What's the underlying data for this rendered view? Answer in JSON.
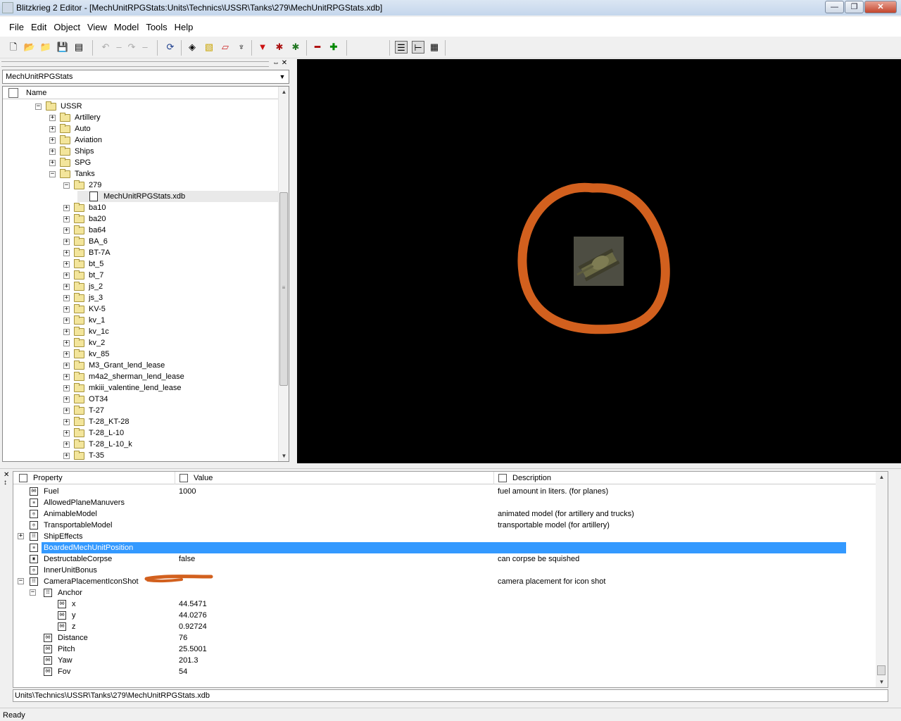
{
  "window": {
    "title": "Blitzkrieg 2 Editor - [MechUnitRPGStats:Units\\Technics\\USSR\\Tanks\\279\\MechUnitRPGStats.xdb]",
    "minimize": "—",
    "maximize": "❐",
    "close": "✕"
  },
  "menu": [
    "File",
    "Edit",
    "Object",
    "View",
    "Model",
    "Tools",
    "Help"
  ],
  "left_panel": {
    "combo_value": "MechUnitRPGStats",
    "tree_header": "Name",
    "tree": [
      {
        "label": "USSR",
        "indent": 0,
        "expanded": true,
        "type": "folder"
      },
      {
        "label": "Artillery",
        "indent": 1,
        "expanded": false,
        "type": "folder"
      },
      {
        "label": "Auto",
        "indent": 1,
        "expanded": false,
        "type": "folder"
      },
      {
        "label": "Aviation",
        "indent": 1,
        "expanded": false,
        "type": "folder"
      },
      {
        "label": "Ships",
        "indent": 1,
        "expanded": false,
        "type": "folder"
      },
      {
        "label": "SPG",
        "indent": 1,
        "expanded": false,
        "type": "folder"
      },
      {
        "label": "Tanks",
        "indent": 1,
        "expanded": true,
        "type": "folder"
      },
      {
        "label": "279",
        "indent": 2,
        "expanded": true,
        "type": "folder"
      },
      {
        "label": "MechUnitRPGStats.xdb",
        "indent": 3,
        "type": "file",
        "selected": true
      },
      {
        "label": "ba10",
        "indent": 2,
        "expanded": false,
        "type": "folder"
      },
      {
        "label": "ba20",
        "indent": 2,
        "expanded": false,
        "type": "folder"
      },
      {
        "label": "ba64",
        "indent": 2,
        "expanded": false,
        "type": "folder"
      },
      {
        "label": "BA_6",
        "indent": 2,
        "expanded": false,
        "type": "folder"
      },
      {
        "label": "BT-7A",
        "indent": 2,
        "expanded": false,
        "type": "folder"
      },
      {
        "label": "bt_5",
        "indent": 2,
        "expanded": false,
        "type": "folder"
      },
      {
        "label": "bt_7",
        "indent": 2,
        "expanded": false,
        "type": "folder"
      },
      {
        "label": "js_2",
        "indent": 2,
        "expanded": false,
        "type": "folder"
      },
      {
        "label": "js_3",
        "indent": 2,
        "expanded": false,
        "type": "folder"
      },
      {
        "label": "KV-5",
        "indent": 2,
        "expanded": false,
        "type": "folder"
      },
      {
        "label": "kv_1",
        "indent": 2,
        "expanded": false,
        "type": "folder"
      },
      {
        "label": "kv_1c",
        "indent": 2,
        "expanded": false,
        "type": "folder"
      },
      {
        "label": "kv_2",
        "indent": 2,
        "expanded": false,
        "type": "folder"
      },
      {
        "label": "kv_85",
        "indent": 2,
        "expanded": false,
        "type": "folder"
      },
      {
        "label": "M3_Grant_lend_lease",
        "indent": 2,
        "expanded": false,
        "type": "folder"
      },
      {
        "label": "m4a2_sherman_lend_lease",
        "indent": 2,
        "expanded": false,
        "type": "folder"
      },
      {
        "label": "mkiii_valentine_lend_lease",
        "indent": 2,
        "expanded": false,
        "type": "folder"
      },
      {
        "label": "OT34",
        "indent": 2,
        "expanded": false,
        "type": "folder"
      },
      {
        "label": "T-27",
        "indent": 2,
        "expanded": false,
        "type": "folder"
      },
      {
        "label": "T-28_KT-28",
        "indent": 2,
        "expanded": false,
        "type": "folder"
      },
      {
        "label": "T-28_L-10",
        "indent": 2,
        "expanded": false,
        "type": "folder"
      },
      {
        "label": "T-28_L-10_k",
        "indent": 2,
        "expanded": false,
        "type": "folder"
      },
      {
        "label": "T-35",
        "indent": 2,
        "expanded": false,
        "type": "folder"
      }
    ]
  },
  "properties": {
    "headers": {
      "property": "Property",
      "value": "Value",
      "description": "Description"
    },
    "rows": [
      {
        "name": "Fuel",
        "value": "1000",
        "desc": "fuel amount in liters. (for planes)",
        "indent": 0,
        "icon": "number-icon"
      },
      {
        "name": "AllowedPlaneManuvers",
        "value": "",
        "desc": "",
        "indent": 0,
        "icon": "list-icon"
      },
      {
        "name": "AnimableModel",
        "value": "",
        "desc": "animated model (for artillery and trucks)",
        "indent": 0,
        "icon": "reference-icon"
      },
      {
        "name": "TransportableModel",
        "value": "",
        "desc": "transportable model (for artillery)",
        "indent": 0,
        "icon": "reference-icon"
      },
      {
        "name": "ShipEffects",
        "value": "",
        "desc": "",
        "indent": 0,
        "icon": "struct-icon",
        "expander": "+"
      },
      {
        "name": "BoardedMechUnitPosition",
        "value": "",
        "desc": "",
        "indent": 0,
        "icon": "list-icon",
        "selected": true
      },
      {
        "name": "DestructableCorpse",
        "value": "false",
        "desc": "can corpse be squished",
        "indent": 0,
        "icon": "bool-icon"
      },
      {
        "name": "InnerUnitBonus",
        "value": "",
        "desc": "",
        "indent": 0,
        "icon": "reference-icon"
      },
      {
        "name": "CameraPlacementIconShot",
        "value": "",
        "desc": "camera placement for icon shot",
        "indent": 0,
        "icon": "struct-icon",
        "expander": "−"
      },
      {
        "name": "Anchor",
        "value": "",
        "desc": "",
        "indent": 1,
        "icon": "struct-icon",
        "expander": "−"
      },
      {
        "name": "x",
        "value": "44.5471",
        "desc": "",
        "indent": 2,
        "icon": "number-icon"
      },
      {
        "name": "y",
        "value": "44.0276",
        "desc": "",
        "indent": 2,
        "icon": "number-icon"
      },
      {
        "name": "z",
        "value": "0.92724",
        "desc": "",
        "indent": 2,
        "icon": "number-icon"
      },
      {
        "name": "Distance",
        "value": "76",
        "desc": "",
        "indent": 1,
        "icon": "number-icon"
      },
      {
        "name": "Pitch",
        "value": "25.5001",
        "desc": "",
        "indent": 1,
        "icon": "number-icon"
      },
      {
        "name": "Yaw",
        "value": "201.3",
        "desc": "",
        "indent": 1,
        "icon": "number-icon"
      },
      {
        "name": "Fov",
        "value": "54",
        "desc": "",
        "indent": 1,
        "icon": "number-icon"
      }
    ]
  },
  "path_bar": "Units\\Technics\\USSR\\Tanks\\279\\MechUnitRPGStats.xdb",
  "status": "Ready",
  "colors": {
    "selection": "#3399ff",
    "annotation": "#d2601e",
    "viewport_bg": "#000000"
  }
}
